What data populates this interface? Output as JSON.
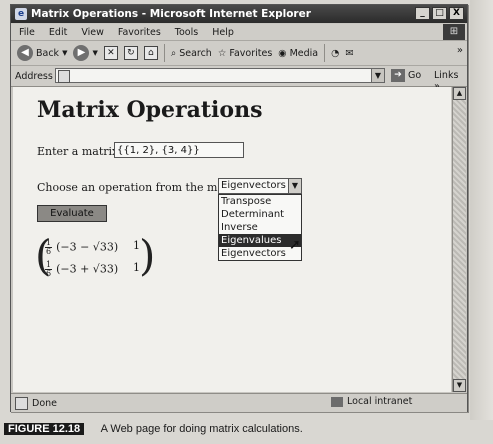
{
  "window": {
    "title": "Matrix Operations - Microsoft Internet Explorer",
    "controls": [
      "_",
      "□",
      "X"
    ]
  },
  "menubar": {
    "items": [
      "File",
      "Edit",
      "View",
      "Favorites",
      "Tools",
      "Help"
    ]
  },
  "toolbar": {
    "back_label": "Back",
    "search_label": "Search",
    "favorites_label": "Favorites",
    "media_label": "Media",
    "more": "»"
  },
  "address": {
    "label": "Address",
    "value": "",
    "go_label": "Go",
    "links_label": "Links"
  },
  "page": {
    "title": "Matrix Operations",
    "matrix_label": "Enter a matrix:",
    "matrix_value": "{{1, 2}, {3, 4}}",
    "operation_label": "Choose an operation from the menu:",
    "selected_operation": "Eigenvectors",
    "operations": [
      "Transpose",
      "Determinant",
      "Inverse",
      "Eigenvalues",
      "Eigenvectors"
    ],
    "highlighted_operation": "Eigenvalues",
    "evaluate_label": "Evaluate"
  },
  "result": {
    "frac_num": "1",
    "frac_den": "6",
    "row1_expr": "(−3 − √33)",
    "row2_expr": "(−3 + √33)",
    "row1_col2": "1",
    "row2_col2": "1"
  },
  "status": {
    "text": "Done",
    "zone": "Local intranet"
  },
  "caption": {
    "figure": "FIGURE 12.18",
    "text": "A Web page for doing matrix calculations."
  }
}
